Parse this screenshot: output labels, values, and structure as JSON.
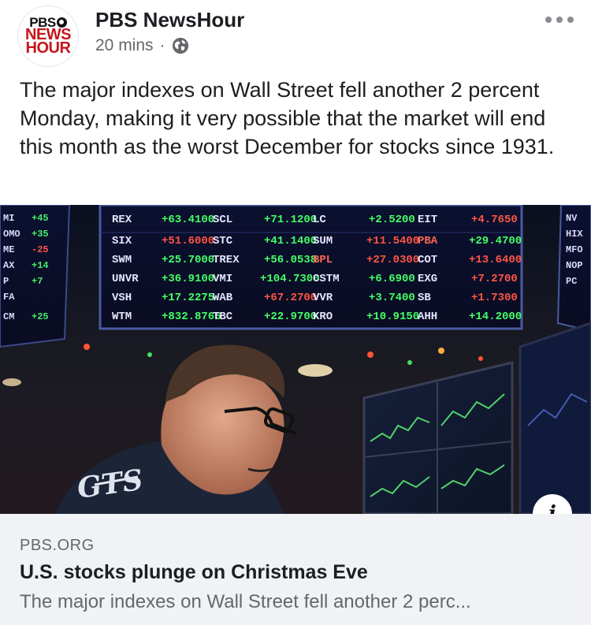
{
  "post": {
    "page_name": "PBS NewsHour",
    "avatar": {
      "line1": "PBS",
      "line2": "NEWS",
      "line3": "HOUR"
    },
    "time": "20 mins",
    "separator": "·",
    "privacy_icon": "globe-icon",
    "more_icon": "ellipsis-icon",
    "text": "The major indexes on Wall Street fell another 2 percent Monday, making it very possible that the market will end this month as the worst December for stocks since 1931."
  },
  "link": {
    "image_icon": "info-icon",
    "info_glyph": "i",
    "domain": "PBS.ORG",
    "title": "U.S. stocks plunge on Christmas Eve",
    "description": "The major indexes on Wall Street fell another 2 perc..."
  },
  "image_text": {
    "jacket": "GTS",
    "tickers": [
      "REX",
      "SIX",
      "SWM",
      "UNVR",
      "VSH",
      "WTM",
      "SCL",
      "STC",
      "TREX",
      "VMI",
      "WAB",
      "TBC",
      "LC",
      "SUM",
      "BPL",
      "CSTM",
      "VVR",
      "KRO",
      "EIT",
      "PBA",
      "COT",
      "EXG",
      "SB",
      "AHH"
    ]
  },
  "colors": {
    "brand_red": "#c4161c",
    "link_bg": "#f0f2f5",
    "muted": "#65676b",
    "text": "#1c1e21"
  }
}
